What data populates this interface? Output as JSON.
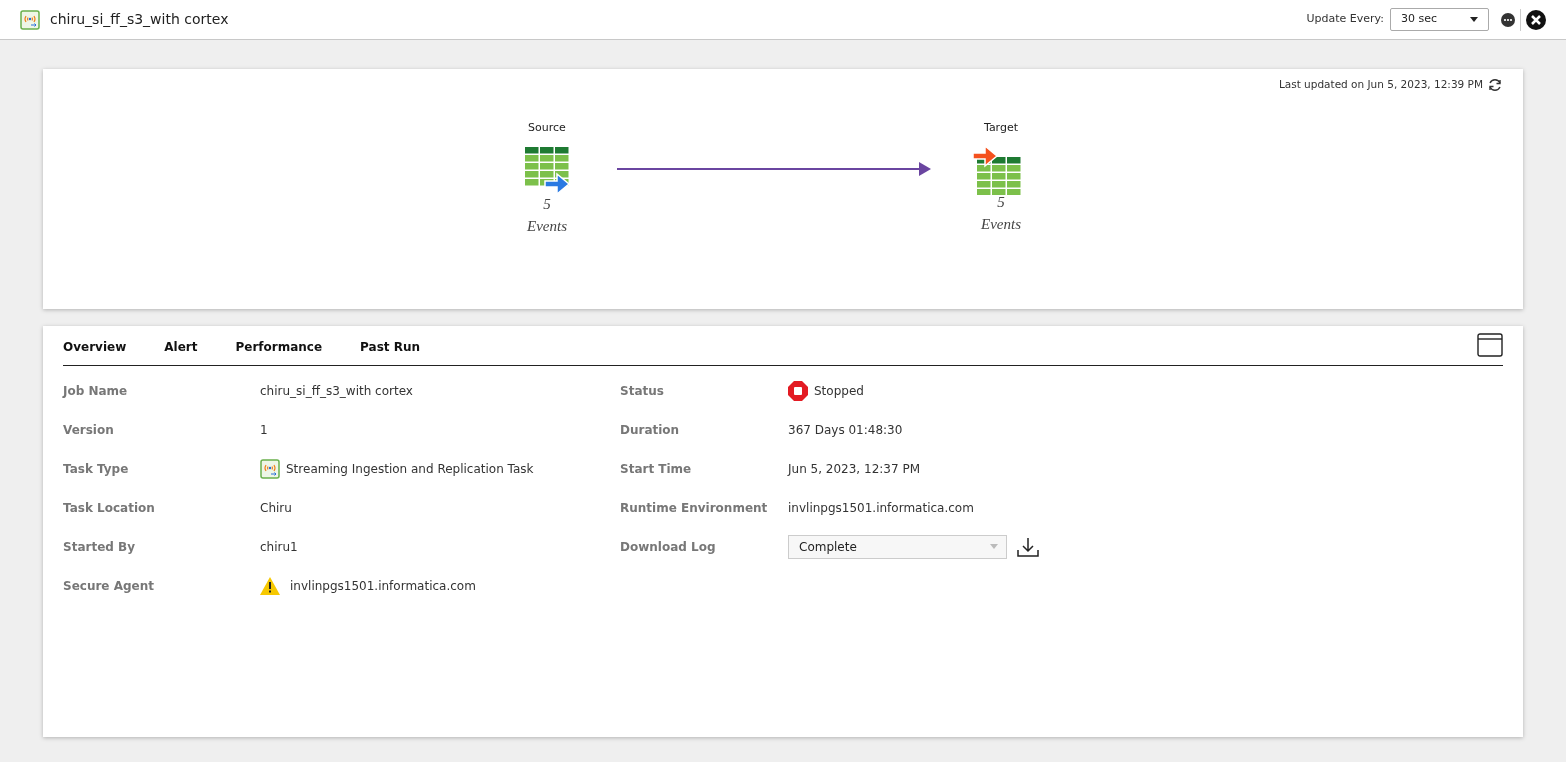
{
  "header": {
    "title": "chiru_si_ff_s3_with cortex",
    "update_label": "Update Every:",
    "update_value": "30 sec"
  },
  "flow": {
    "last_updated": "Last updated on Jun 5, 2023, 12:39 PM",
    "nodes": [
      {
        "kind": "source",
        "label": "Source",
        "count": "5",
        "unit": "Events"
      },
      {
        "kind": "target",
        "label": "Target",
        "count": "5",
        "unit": "Events"
      }
    ]
  },
  "tabs": [
    {
      "label": "Overview"
    },
    {
      "label": "Alert"
    },
    {
      "label": "Performance"
    },
    {
      "label": "Past Run"
    }
  ],
  "details_left": [
    {
      "kind": "text",
      "label": "Job Name",
      "value": "chiru_si_ff_s3_with cortex"
    },
    {
      "kind": "text",
      "label": "Version",
      "value": "1"
    },
    {
      "kind": "task",
      "label": "Task Type",
      "value": "Streaming Ingestion and Replication Task"
    },
    {
      "kind": "text",
      "label": "Task Location",
      "value": "Chiru"
    },
    {
      "kind": "text",
      "label": "Started By",
      "value": "chiru1"
    },
    {
      "kind": "warning",
      "label": "Secure Agent",
      "value": "invlinpgs1501.informatica.com"
    }
  ],
  "details_right": [
    {
      "kind": "status",
      "label": "Status",
      "value": "Stopped"
    },
    {
      "kind": "text",
      "label": "Duration",
      "value": "367 Days 01:48:30"
    },
    {
      "kind": "text",
      "label": "Start Time",
      "value": "Jun 5, 2023, 12:37 PM"
    },
    {
      "kind": "text",
      "label": "Runtime Environment",
      "value": "invlinpgs1501.informatica.com"
    },
    {
      "kind": "select",
      "label": "Download Log",
      "value": "Complete"
    }
  ]
}
